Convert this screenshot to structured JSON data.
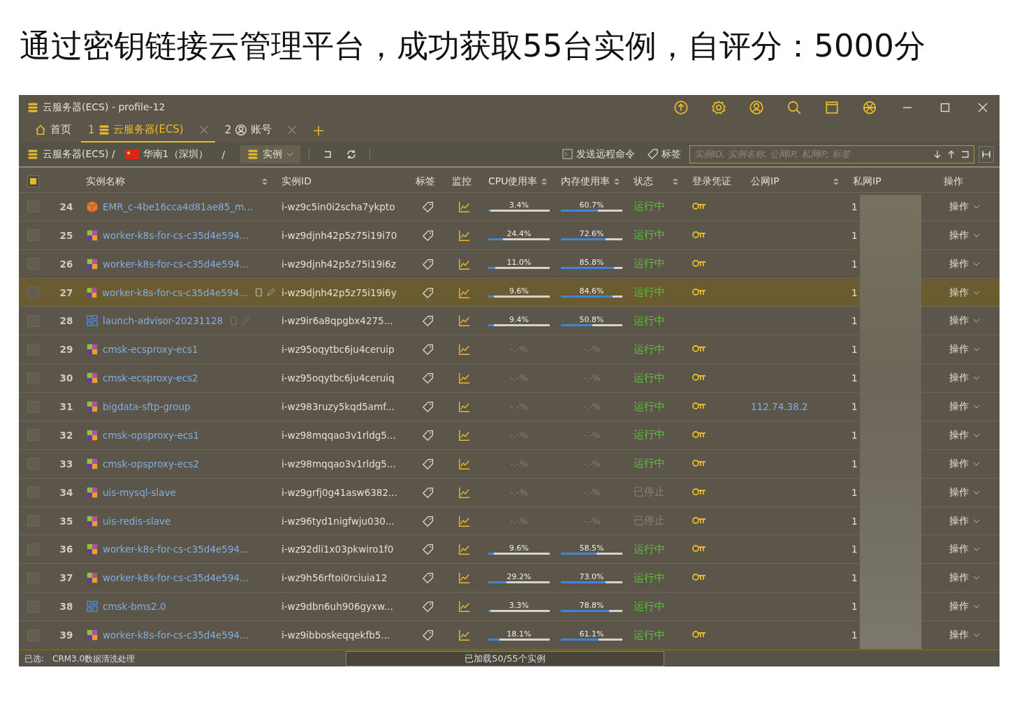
{
  "headline": "通过密钥链接云管理平台，成功获取55台实例，自评分：5000分",
  "window": {
    "title": "云服务器(ECS) - profile-12"
  },
  "tabs": [
    {
      "kind": "home",
      "label": "首页",
      "selected": false
    },
    {
      "kind": "server",
      "number": "1",
      "label": "云服务器(ECS)",
      "selected": true
    },
    {
      "kind": "user",
      "number": "2",
      "label": "账号",
      "selected": false
    }
  ],
  "breadcrumb": {
    "service": "云服务器(ECS) /",
    "region": "华南1（深圳）",
    "separator": "/",
    "resource": "实例"
  },
  "toolbar": {
    "command": "发送远程命令",
    "tags": "标签"
  },
  "search": {
    "placeholder": "实例ID, 实例名称, 公网IP, 私网IP, 标签"
  },
  "table": {
    "header_checkbox_partial": true,
    "columns": [
      {
        "label": "实例名称",
        "sortable": true
      },
      {
        "label": "实例ID",
        "sortable": false
      },
      {
        "label": "标签",
        "sortable": false
      },
      {
        "label": "监控",
        "sortable": false
      },
      {
        "label": "CPU使用率",
        "sortable": true
      },
      {
        "label": "内存使用率",
        "sortable": true
      },
      {
        "label": "状态",
        "sortable": true
      },
      {
        "label": "登录凭证",
        "sortable": false
      },
      {
        "label": "公网IP",
        "sortable": true
      },
      {
        "label": "私网IP",
        "sortable": false
      },
      {
        "label": "操作",
        "sortable": false
      }
    ],
    "rows": [
      {
        "number": "24",
        "kind": "emr",
        "name": "EMR_c-4be16cca4d81ae85_m...",
        "tools_shown": false,
        "id": "i-wz9c5in0i2scha7ykpto",
        "cpu": {
          "text": "3.4%",
          "level": 0.034
        },
        "memory": {
          "text": "60.7%",
          "level": 0.607
        },
        "status": "运行中",
        "stopped": false,
        "key": true,
        "private_ip": "1",
        "action": "操作",
        "selected": false
      },
      {
        "number": "25",
        "kind": "k8s",
        "name": "worker-k8s-for-cs-c35d4e594...",
        "tools_shown": false,
        "id": "i-wz9djnh42p5z75i19i70",
        "cpu": {
          "text": "24.4%",
          "level": 0.244
        },
        "memory": {
          "text": "72.6%",
          "level": 0.726
        },
        "status": "运行中",
        "stopped": false,
        "key": true,
        "private_ip": "1",
        "action": "操作",
        "selected": false
      },
      {
        "number": "26",
        "kind": "k8s",
        "name": "worker-k8s-for-cs-c35d4e594...",
        "tools_shown": false,
        "id": "i-wz9djnh42p5z75i19i6z",
        "cpu": {
          "text": "11.0%",
          "level": 0.11
        },
        "memory": {
          "text": "85.8%",
          "level": 0.858
        },
        "status": "运行中",
        "stopped": false,
        "key": true,
        "private_ip": "1",
        "action": "操作",
        "selected": false
      },
      {
        "number": "27",
        "kind": "k8s",
        "name": "worker-k8s-for-cs-c35d4e594...",
        "tools_shown": true,
        "id": "i-wz9djnh42p5z75i19i6y",
        "cpu": {
          "text": "9.6%",
          "level": 0.096
        },
        "memory": {
          "text": "84.6%",
          "level": 0.846
        },
        "status": "运行中",
        "stopped": false,
        "key": true,
        "private_ip": "1",
        "action": "操作",
        "selected": true
      },
      {
        "number": "28",
        "kind": "grid",
        "name": "launch-advisor-20231128",
        "tools_shown": true,
        "id": "i-wz9ir6a8qpgbx4275...",
        "cpu": {
          "text": "9.4%",
          "level": 0.094
        },
        "memory": {
          "text": "50.8%",
          "level": 0.508
        },
        "status": "运行中",
        "stopped": false,
        "key": false,
        "private_ip": "1",
        "action": "操作",
        "selected": false
      },
      {
        "number": "29",
        "kind": "k8s",
        "name": "cmsk-ecsproxy-ecs1",
        "tools_shown": false,
        "id": "i-wz95oqytbc6ju4ceruip",
        "cpu": {
          "text": "-.-%"
        },
        "memory": {
          "text": "-.-%"
        },
        "status": "运行中",
        "stopped": false,
        "key": true,
        "private_ip": "1",
        "action": "操作",
        "selected": false
      },
      {
        "number": "30",
        "kind": "k8s",
        "name": "cmsk-ecsproxy-ecs2",
        "tools_shown": false,
        "id": "i-wz95oqytbc6ju4ceruiq",
        "cpu": {
          "text": "-.-%"
        },
        "memory": {
          "text": "-.-%"
        },
        "status": "运行中",
        "stopped": false,
        "key": true,
        "private_ip": "1",
        "action": "操作",
        "selected": false
      },
      {
        "number": "31",
        "kind": "k8s",
        "name": "bigdata-sftp-group",
        "tools_shown": false,
        "id": "i-wz983ruzy5kqd5amf...",
        "cpu": {
          "text": "-.-%"
        },
        "memory": {
          "text": "-.-%"
        },
        "status": "运行中",
        "stopped": false,
        "key": true,
        "public_ip": "112.74.38.2",
        "private_ip": "1",
        "action": "操作",
        "selected": false
      },
      {
        "number": "32",
        "kind": "k8s",
        "name": "cmsk-opsproxy-ecs1",
        "tools_shown": false,
        "id": "i-wz98mqqao3v1rldg5...",
        "cpu": {
          "text": "-.-%"
        },
        "memory": {
          "text": "-.-%"
        },
        "status": "运行中",
        "stopped": false,
        "key": true,
        "private_ip": "1",
        "action": "操作",
        "selected": false
      },
      {
        "number": "33",
        "kind": "k8s",
        "name": "cmsk-opsproxy-ecs2",
        "tools_shown": false,
        "id": "i-wz98mqqao3v1rldg5...",
        "cpu": {
          "text": "-.-%"
        },
        "memory": {
          "text": "-.-%"
        },
        "status": "运行中",
        "stopped": false,
        "key": true,
        "private_ip": "1",
        "action": "操作",
        "selected": false
      },
      {
        "number": "34",
        "kind": "k8s",
        "name": "uis-mysql-slave",
        "tools_shown": false,
        "id": "i-wz9grfj0g41asw6382...",
        "cpu": {
          "text": "-.-%"
        },
        "memory": {
          "text": "-.-%"
        },
        "status": "已停止",
        "stopped": true,
        "key": true,
        "private_ip": "1",
        "action": "操作",
        "selected": false
      },
      {
        "number": "35",
        "kind": "k8s",
        "name": "uis-redis-slave",
        "tools_shown": false,
        "id": "i-wz96tyd1nigfwju030...",
        "cpu": {
          "text": "-.-%"
        },
        "memory": {
          "text": "-.-%"
        },
        "status": "已停止",
        "stopped": true,
        "key": true,
        "private_ip": "1",
        "action": "操作",
        "selected": false
      },
      {
        "number": "36",
        "kind": "k8s",
        "name": "worker-k8s-for-cs-c35d4e594...",
        "tools_shown": false,
        "id": "i-wz92dli1x03pkwiro1f0",
        "cpu": {
          "text": "9.6%",
          "level": 0.096
        },
        "memory": {
          "text": "58.5%",
          "level": 0.585
        },
        "status": "运行中",
        "stopped": false,
        "key": true,
        "private_ip": "1",
        "action": "操作",
        "selected": false
      },
      {
        "number": "37",
        "kind": "k8s",
        "name": "worker-k8s-for-cs-c35d4e594...",
        "tools_shown": false,
        "id": "i-wz9h56rftoi0rciuia12",
        "cpu": {
          "text": "29.2%",
          "level": 0.292
        },
        "memory": {
          "text": "73.0%",
          "level": 0.73
        },
        "status": "运行中",
        "stopped": false,
        "key": true,
        "private_ip": "1",
        "action": "操作",
        "selected": false
      },
      {
        "number": "38",
        "kind": "grid",
        "name": "cmsk-bms2.0",
        "tools_shown": false,
        "id": "i-wz9dbn6uh906gyxw...",
        "cpu": {
          "text": "3.3%",
          "level": 0.033
        },
        "memory": {
          "text": "78.8%",
          "level": 0.788
        },
        "status": "运行中",
        "stopped": false,
        "key": false,
        "private_ip": "1",
        "action": "操作",
        "selected": false
      },
      {
        "number": "39",
        "kind": "k8s",
        "name": "worker-k8s-for-cs-c35d4e594...",
        "tools_shown": false,
        "id": "i-wz9ibboskeqqekfb5...",
        "cpu": {
          "text": "18.1%",
          "level": 0.181
        },
        "memory": {
          "text": "61.1%",
          "level": 0.611
        },
        "status": "运行中",
        "stopped": false,
        "key": true,
        "private_ip": "1",
        "action": "操作",
        "selected": false
      }
    ]
  },
  "footer": {
    "selected_label": "已选:",
    "selected_value": "CRM3.0数据清洗处理",
    "loaded": "已加载50/55个实例"
  }
}
